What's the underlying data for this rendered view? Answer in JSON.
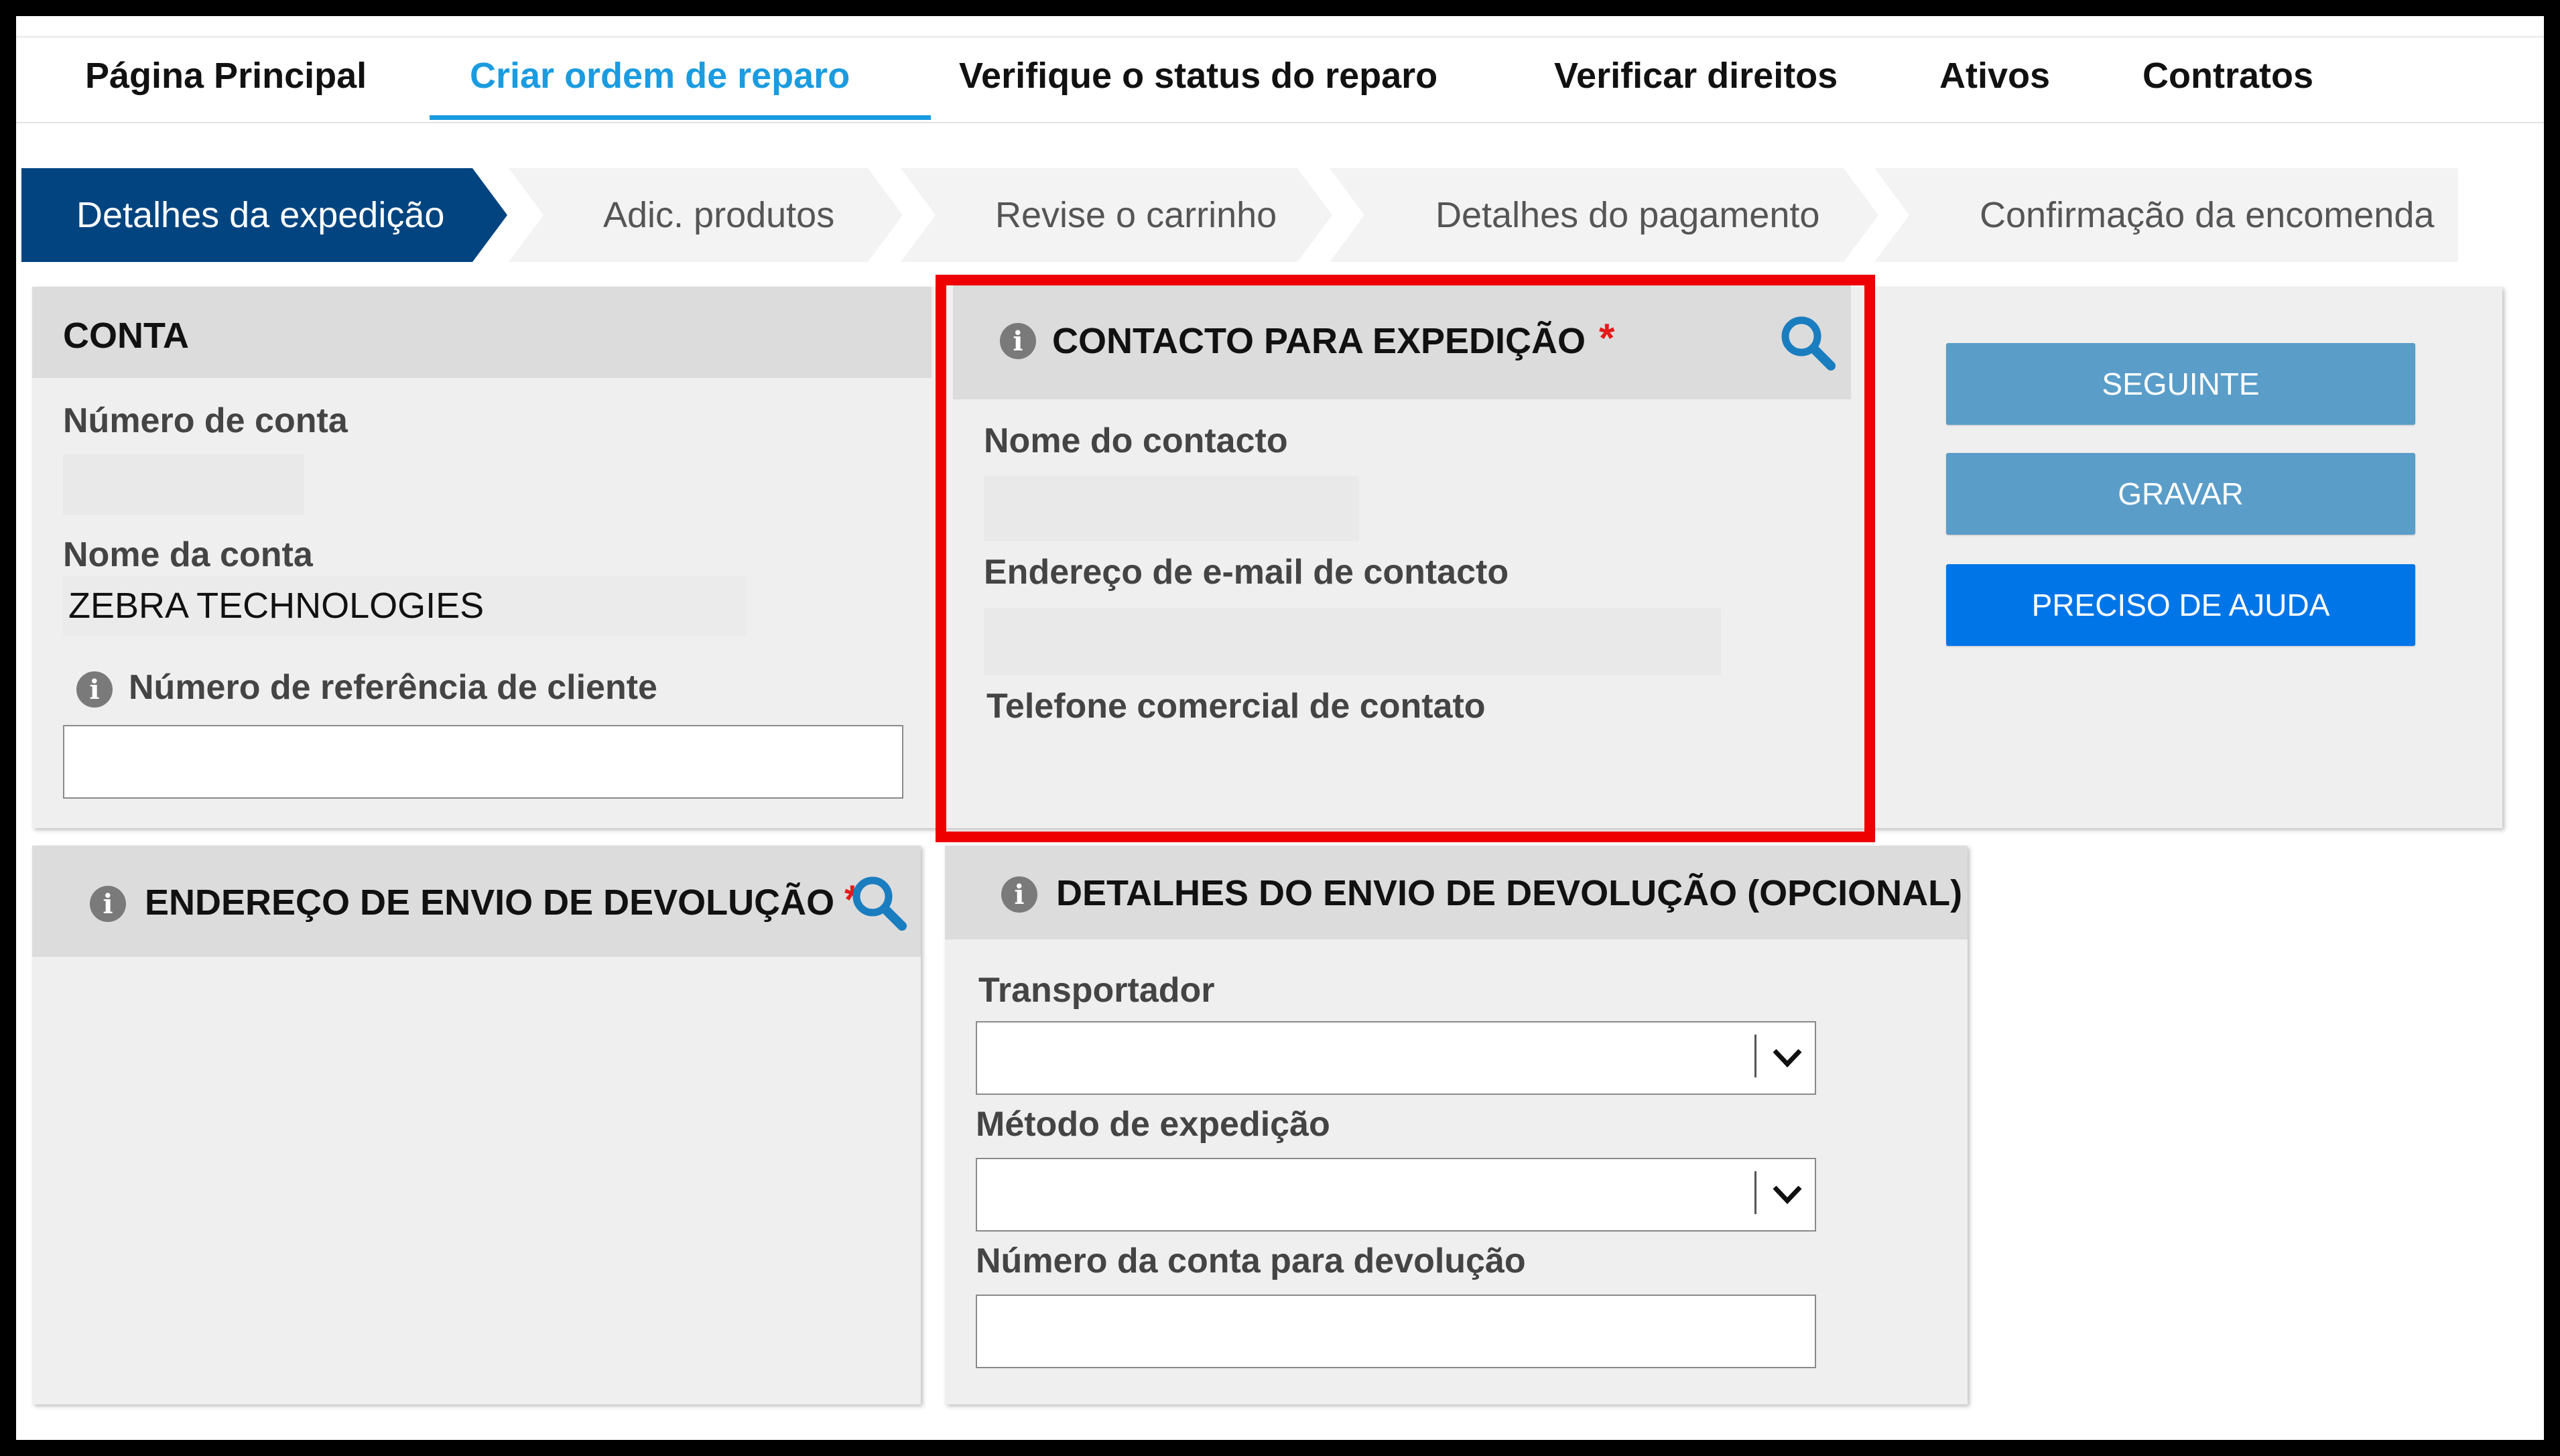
{
  "nav": {
    "items": [
      {
        "label": "Página Principal"
      },
      {
        "label": "Criar ordem de reparo"
      },
      {
        "label": "Verifique o status do reparo"
      },
      {
        "label": "Verificar direitos"
      },
      {
        "label": "Ativos"
      },
      {
        "label": "Contratos"
      }
    ],
    "active_index": 1
  },
  "steps": [
    {
      "label": "Detalhes da expedição"
    },
    {
      "label": "Adic. produtos"
    },
    {
      "label": "Revise o carrinho"
    },
    {
      "label": "Detalhes do pagamento"
    },
    {
      "label": "Confirmação da encomenda"
    }
  ],
  "account": {
    "title": "CONTA",
    "number_label": "Número de conta",
    "number_value": "",
    "name_label": "Nome da conta",
    "name_value": "ZEBRA TECHNOLOGIES",
    "ref_label": "Número de referência de cliente",
    "ref_value": ""
  },
  "shipping_contact": {
    "title": "CONTACTO PARA EXPEDIÇÃO",
    "required_mark": "*",
    "contact_name_label": "Nome do contacto",
    "email_label": "Endereço de e-mail de contacto",
    "phone_label": "Telefone comercial de contato"
  },
  "actions": {
    "next": "SEGUINTE",
    "save": "GRAVAR",
    "help": "PRECISO DE AJUDA"
  },
  "return_address": {
    "title": "ENDEREÇO DE ENVIO DE DEVOLUÇÃO",
    "required_mark": "*"
  },
  "return_details": {
    "title": "DETALHES DO ENVIO DE DEVOLUÇÃO (OPCIONAL)",
    "carrier_label": "Transportador",
    "carrier_value": "",
    "method_label": "Método de expedição",
    "method_value": "",
    "account_label": "Número da conta para devolução",
    "account_value": ""
  },
  "colors": {
    "accent": "#1b9be0",
    "active_step": "#014480",
    "button_light": "#5a9dc9",
    "button_primary": "#0075e8",
    "highlight": "#ee0000",
    "required": "#e31b1b"
  }
}
